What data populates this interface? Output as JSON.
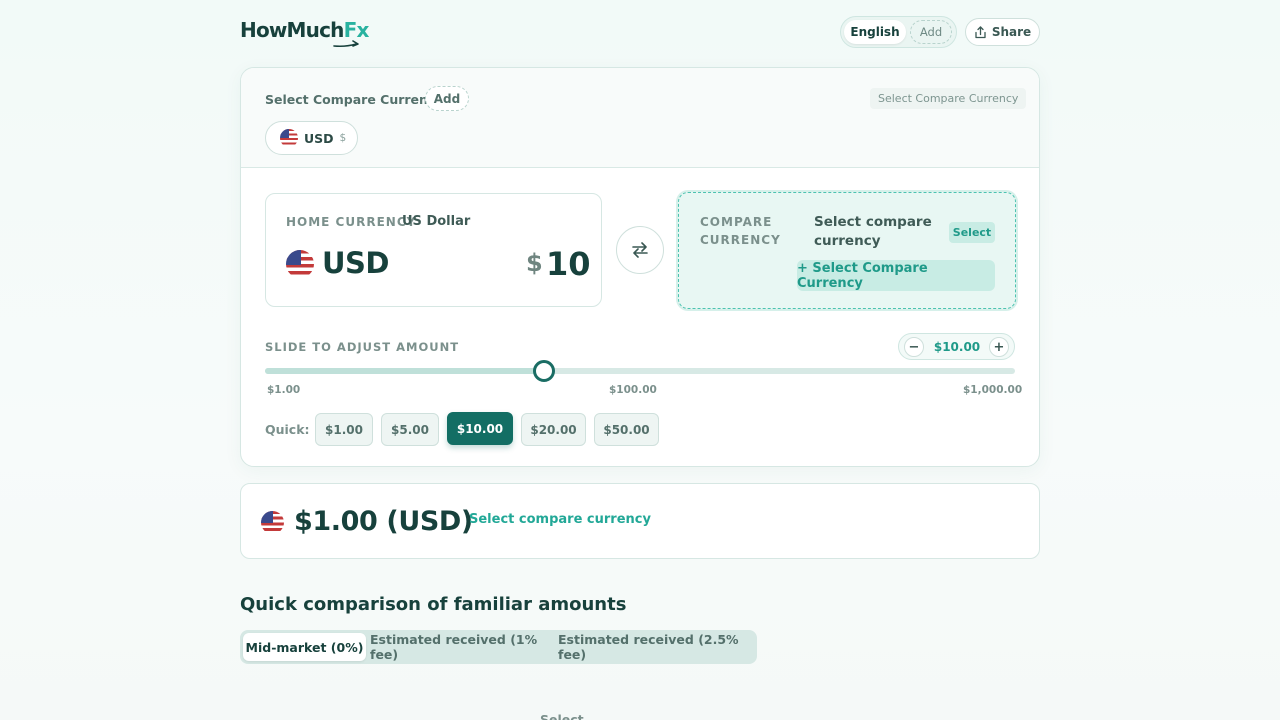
{
  "header": {
    "logo_main": "HowMuch",
    "logo_accent": "Fx",
    "language": "English",
    "language_add": "Add",
    "share": "Share"
  },
  "compare_select": {
    "label": "Select Compare Currency",
    "add": "Add",
    "tag": "Select Compare Currency",
    "chip_code": "USD",
    "chip_symbol": "$"
  },
  "home": {
    "label": "HOME CURRENCY",
    "name": "US Dollar",
    "code": "USD",
    "symbol": "$",
    "amount": "10"
  },
  "compare": {
    "label": "COMPARE CURRENCY",
    "text": "Select compare currency",
    "select": "Select",
    "cta": "+ Select Compare Currency"
  },
  "slider": {
    "label": "SLIDE TO ADJUST AMOUNT",
    "minus": "−",
    "plus": "+",
    "value_display": "$10.00",
    "min": 1,
    "max": 1000,
    "value": 10,
    "scale": "log",
    "ticks": [
      "$1.00",
      "$100.00",
      "$1,000.00"
    ]
  },
  "quick": {
    "label": "Quick:",
    "options": [
      "$1.00",
      "$5.00",
      "$10.00",
      "$20.00",
      "$50.00"
    ],
    "active_index": 2
  },
  "result": {
    "amount": "$1.00 (USD)",
    "link": "Select compare currency"
  },
  "comparison": {
    "title": "Quick comparison of familiar amounts",
    "tabs": [
      "Mid-market (0%)",
      "Estimated received (1% fee)",
      "Estimated received (2.5% fee)"
    ],
    "active_index": 0
  },
  "peek": {
    "text": "Select"
  },
  "colors": {
    "primary": "#136e64",
    "accent": "#22a897",
    "text": "#17413c"
  }
}
